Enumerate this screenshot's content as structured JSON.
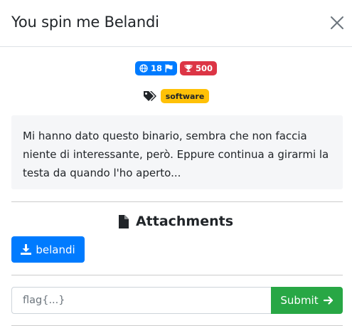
{
  "modal": {
    "title": "You spin me Belandi",
    "solves": "18",
    "points": "500",
    "tag": "software",
    "description": "Mi hanno dato questo binario, sembra che non faccia niente di interessante, però. Eppure continua a girarmi la testa da quando l'ho aperto...",
    "attachments_title": "Attachments",
    "attachment_name": "belandi",
    "flag_placeholder": "flag{...}",
    "submit_label": "Submit"
  },
  "colors": {
    "primary": "#007bff",
    "danger": "#dc3545",
    "warning": "#ffc107",
    "success": "#28a745"
  },
  "icons": [
    "close-icon",
    "globe-icon",
    "flag-icon",
    "trophy-icon",
    "tags-icon",
    "file-icon",
    "download-icon",
    "arrow-right-icon"
  ]
}
